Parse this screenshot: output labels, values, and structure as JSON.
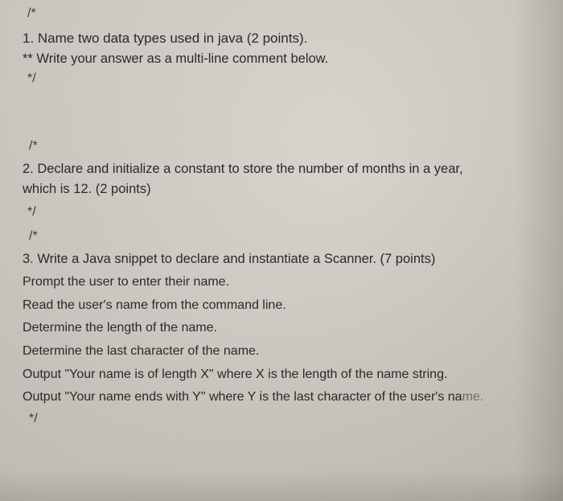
{
  "q1": {
    "open": "/*",
    "title": "1. Name two data types used in java (2 points).",
    "sub": "** Write your answer as a multi-line comment below.",
    "close": "*/"
  },
  "q2": {
    "open": "/*",
    "title": "2. Declare and initialize a constant to store the number of months in a year,",
    "sub": "which is 12. (2 points)",
    "close": "*/"
  },
  "q3": {
    "open": "/*",
    "line1": "3. Write a Java snippet to declare and instantiate a Scanner. (7 points)",
    "line2": "Prompt the user to enter their name.",
    "line3": "Read the user's name from the command line.",
    "line4": "Determine the length of the name.",
    "line5": "Determine the last character of the name.",
    "line6": "Output \"Your name is of length X\" where X is the length of the name string.",
    "line7a": "Output \"Your name ends with Y\" where Y is the last character of the user's na",
    "line7b": "me.",
    "close": "*/"
  }
}
